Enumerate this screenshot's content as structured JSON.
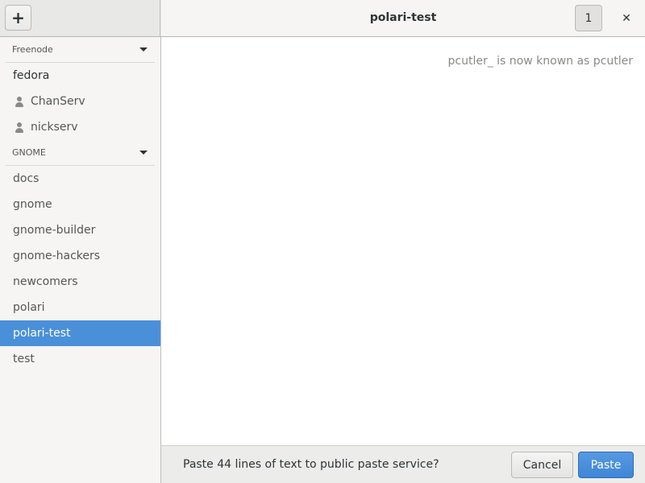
{
  "header": {
    "add_label": "+",
    "title": "polari-test",
    "user_count": "1",
    "close_label": "✕"
  },
  "sidebar": {
    "networks": [
      {
        "name": "Freenode",
        "rooms": [
          {
            "label": "fedora",
            "type": "channel",
            "bold": true
          },
          {
            "label": "ChanServ",
            "type": "query"
          },
          {
            "label": "nickserv",
            "type": "query"
          }
        ]
      },
      {
        "name": "GNOME",
        "rooms": [
          {
            "label": "docs",
            "type": "channel"
          },
          {
            "label": "gnome",
            "type": "channel"
          },
          {
            "label": "gnome-builder",
            "type": "channel"
          },
          {
            "label": "gnome-hackers",
            "type": "channel"
          },
          {
            "label": "newcomers",
            "type": "channel"
          },
          {
            "label": "polari",
            "type": "channel"
          },
          {
            "label": "polari-test",
            "type": "channel",
            "selected": true
          },
          {
            "label": "test",
            "type": "channel"
          }
        ]
      }
    ]
  },
  "chat": {
    "status_message": "pcutler_ is now known as pcutler"
  },
  "pastebar": {
    "prompt": "Paste 44 lines of text to public paste service?",
    "cancel_label": "Cancel",
    "paste_label": "Paste"
  },
  "colors": {
    "selected": "#4a90d9",
    "accent_button": "#4a90d9",
    "sidebar_bg": "#f6f5f4"
  }
}
